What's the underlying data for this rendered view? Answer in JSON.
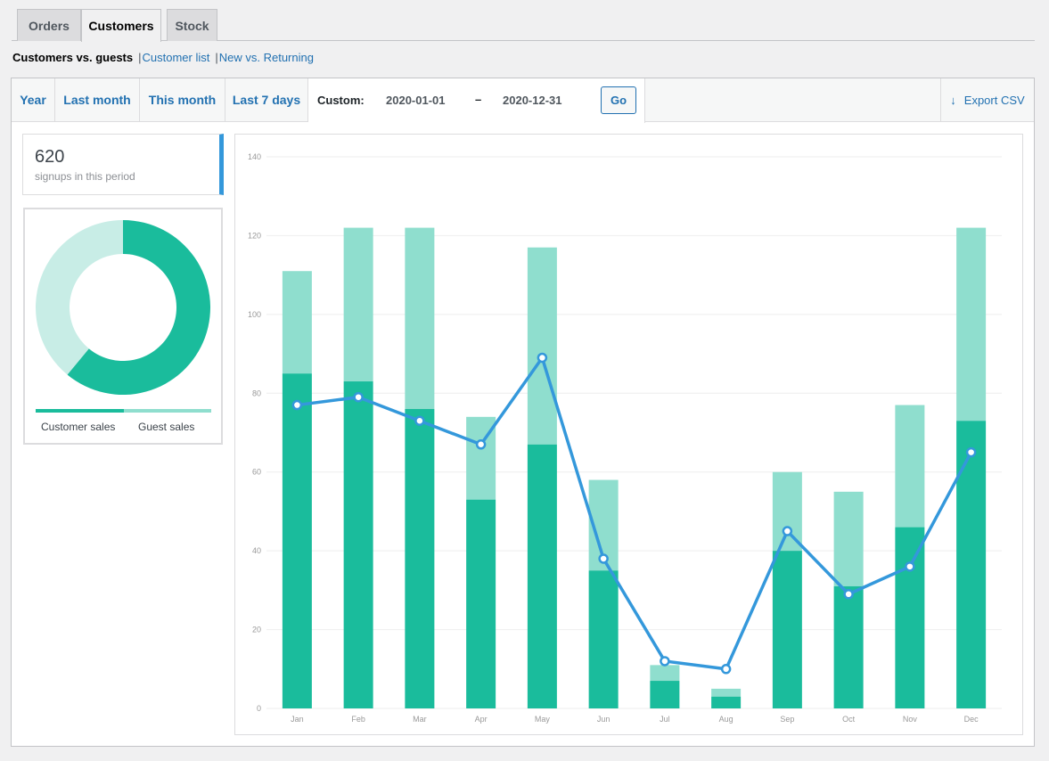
{
  "tabs": [
    {
      "label": "Orders",
      "active": false
    },
    {
      "label": "Customers",
      "active": true
    },
    {
      "label": "Stock",
      "active": false
    }
  ],
  "subnav": {
    "current": "Customers vs. guests",
    "links": [
      "Customer list",
      "New vs. Returning"
    ]
  },
  "ranges": [
    "Year",
    "Last month",
    "This month",
    "Last 7 days"
  ],
  "custom": {
    "label": "Custom:",
    "start": "2020-01-01",
    "dash": "–",
    "end": "2020-12-31",
    "go": "Go"
  },
  "export": {
    "label": "Export CSV",
    "icon": "download-arrow-icon"
  },
  "stat": {
    "value": "620",
    "caption": "signups in this period"
  },
  "pie": {
    "segments": [
      {
        "name": "Customer sales",
        "fraction": 0.61,
        "color": "#1abc9c"
      },
      {
        "name": "Guest sales",
        "fraction": 0.39,
        "color": "#c8ede6"
      }
    ],
    "legend_colors": [
      "#1abc9c",
      "#8fdece"
    ]
  },
  "colors": {
    "customer": "#1abc9c",
    "guest": "#8fdece",
    "line": "#3498db",
    "accent": "#2271b1"
  },
  "chart_data": {
    "type": "bar",
    "stacked": true,
    "categories": [
      "Jan",
      "Feb",
      "Mar",
      "Apr",
      "May",
      "Jun",
      "Jul",
      "Aug",
      "Sep",
      "Oct",
      "Nov",
      "Dec"
    ],
    "series": [
      {
        "values": [
          85,
          83,
          76,
          53,
          67,
          35,
          7,
          3,
          40,
          31,
          46,
          73
        ]
      },
      {
        "values": [
          26,
          39,
          46,
          21,
          50,
          23,
          4,
          2,
          20,
          24,
          31,
          49
        ]
      },
      {
        "type": "line",
        "values": [
          77,
          79,
          73,
          67,
          89,
          38,
          12,
          10,
          45,
          29,
          36,
          65
        ]
      }
    ],
    "yticks": [
      0,
      20,
      40,
      60,
      80,
      100,
      120,
      140
    ],
    "ylim": [
      0,
      140
    ],
    "grid": true
  }
}
